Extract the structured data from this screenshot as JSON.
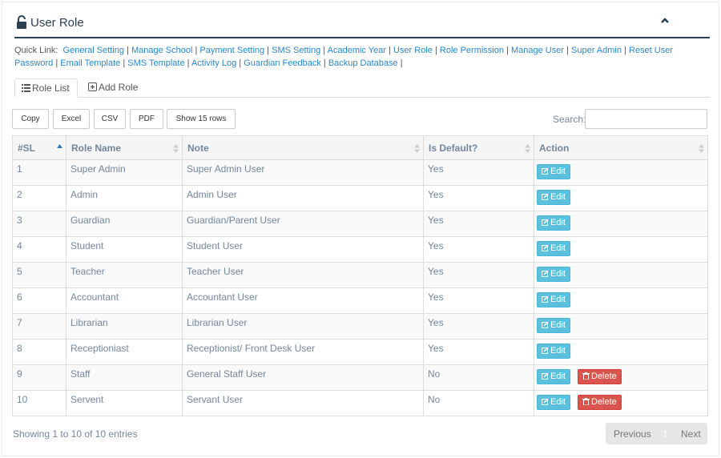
{
  "header": {
    "title": "User Role",
    "title_icon": "unlock-icon",
    "collapse_icon": "chevron-up-icon"
  },
  "quick_links": {
    "label": "Quick Link:",
    "links": [
      "General Setting",
      "Manage School",
      "Payment Setting",
      "SMS Setting",
      "Academic Year",
      "User Role",
      "Role Permission",
      "Manage User",
      "Super Admin",
      "Reset User Password",
      "Email Template",
      "SMS Template",
      "Activity Log",
      "Guardian Feedback",
      "Backup Database"
    ]
  },
  "tabs": [
    {
      "label": "Role List",
      "icon": "list-icon",
      "active": true
    },
    {
      "label": "Add Role",
      "icon": "plus-square-icon",
      "active": false
    }
  ],
  "toolbar": {
    "copy": "Copy",
    "excel": "Excel",
    "csv": "CSV",
    "pdf": "PDF",
    "show_rows": "Show 15 rows"
  },
  "search": {
    "label": "Search:",
    "value": ""
  },
  "table": {
    "columns": [
      "#SL",
      "Role Name",
      "Note",
      "Is Default?",
      "Action"
    ],
    "rows": [
      {
        "sl": "1",
        "name": "Super Admin",
        "note": "Super Admin User",
        "default": "Yes",
        "deletable": false
      },
      {
        "sl": "2",
        "name": "Admin",
        "note": "Admin User",
        "default": "Yes",
        "deletable": false
      },
      {
        "sl": "3",
        "name": "Guardian",
        "note": "Guardian/Parent User",
        "default": "Yes",
        "deletable": false
      },
      {
        "sl": "4",
        "name": "Student",
        "note": "Student User",
        "default": "Yes",
        "deletable": false
      },
      {
        "sl": "5",
        "name": "Teacher",
        "note": "Teacher User",
        "default": "Yes",
        "deletable": false
      },
      {
        "sl": "6",
        "name": "Accountant",
        "note": "Accountant User",
        "default": "Yes",
        "deletable": false
      },
      {
        "sl": "7",
        "name": "Librarian",
        "note": "Librarian User",
        "default": "Yes",
        "deletable": false
      },
      {
        "sl": "8",
        "name": "Receptioniast",
        "note": "Receptionist/ Front Desk User",
        "default": "Yes",
        "deletable": false
      },
      {
        "sl": "9",
        "name": "Staff",
        "note": "General Staff User",
        "default": "No",
        "deletable": true
      },
      {
        "sl": "10",
        "name": "Servent",
        "note": "Servant User",
        "default": "No",
        "deletable": true
      }
    ],
    "edit_label": "Edit",
    "delete_label": "Delete"
  },
  "footer": {
    "info": "Showing 1 to 10 of 10 entries",
    "previous": "Previous",
    "page": "1",
    "next": "Next"
  },
  "colors": {
    "accent": "#2a3f54",
    "link": "#2a87c8",
    "edit": "#5bc0de",
    "delete": "#d9534f"
  }
}
